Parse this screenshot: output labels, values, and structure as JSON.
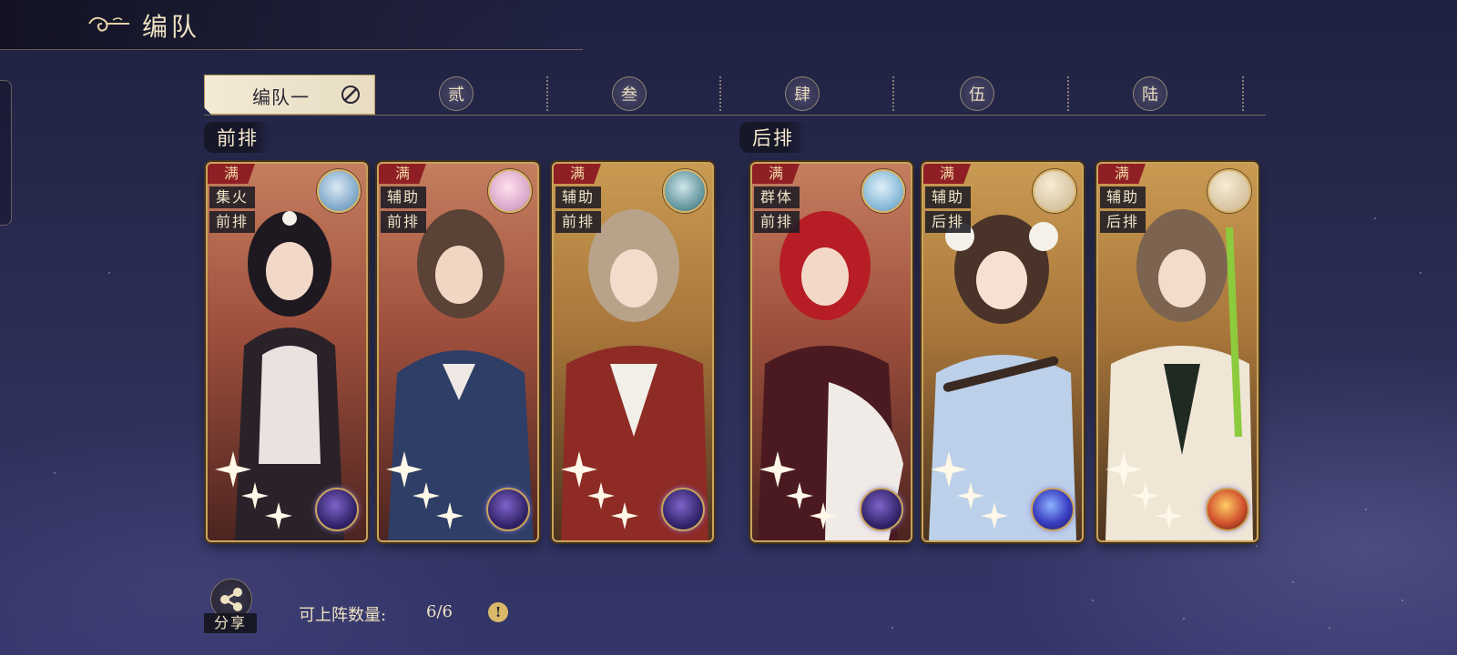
{
  "header": {
    "title": "编队"
  },
  "tabs": {
    "active_label": "编队一",
    "items": [
      "贰",
      "叁",
      "肆",
      "伍",
      "陆"
    ]
  },
  "sections": {
    "front": "前排",
    "back": "后排"
  },
  "cards": [
    {
      "level_tag": "满",
      "role": "集火",
      "position": "前排",
      "pet_icon": "dragon-icon",
      "orb_icon": "planet-orb-icon"
    },
    {
      "level_tag": "满",
      "role": "辅助",
      "position": "前排",
      "pet_icon": "pig-icon",
      "orb_icon": "planet-orb-icon"
    },
    {
      "level_tag": "满",
      "role": "辅助",
      "position": "前排",
      "pet_icon": "rooster-icon",
      "orb_icon": "planet-orb-icon"
    },
    {
      "level_tag": "满",
      "role": "群体",
      "position": "前排",
      "pet_icon": "dog-icon",
      "orb_icon": "planet-orb-icon"
    },
    {
      "level_tag": "满",
      "role": "辅助",
      "position": "后排",
      "pet_icon": "sheep-icon",
      "orb_icon": "blue-orb-icon"
    },
    {
      "level_tag": "满",
      "role": "辅助",
      "position": "后排",
      "pet_icon": "rat-icon",
      "orb_icon": "fire-orb-icon"
    }
  ],
  "footer": {
    "share_label": "分享",
    "deploy_label": "可上阵数量:",
    "deploy_value": "6/6",
    "info_icon_text": "!"
  },
  "colors": {
    "background": "#2a2d52",
    "card_border": "#c9a45c",
    "accent_red": "#8f1f24",
    "text": "#efe2c2"
  }
}
